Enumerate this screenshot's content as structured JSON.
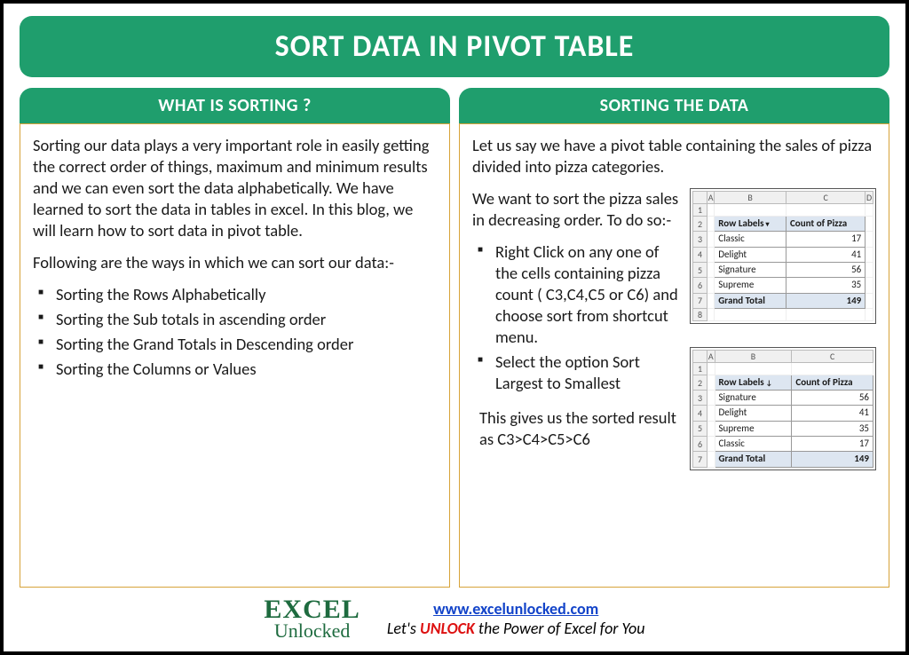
{
  "title": "SORT DATA IN PIVOT TABLE",
  "left": {
    "header": "WHAT IS SORTING ?",
    "para1": "Sorting our data plays a very important role in easily getting the correct order of things, maximum and minimum results and we can even sort the data alphabetically. We have learned to sort the data in tables in excel. In this blog, we will learn how to sort data in pivot table.",
    "para2": "Following are the ways in which we can sort our data:-",
    "bullets": [
      "Sorting the Rows Alphabetically",
      "Sorting the Sub totals in ascending order",
      "Sorting the Grand Totals in Descending order",
      "Sorting the Columns or Values"
    ]
  },
  "right": {
    "header": "SORTING THE DATA",
    "intro": "Let us say we have a pivot table containing the sales of pizza divided into pizza categories.",
    "lead": "We want to sort the pizza sales in decreasing order. To do so:-",
    "steps": [
      "Right Click on any one of the cells containing pizza count ( C3,C4,C5 or C6) and choose sort from shortcut menu.",
      "Select the option Sort Largest to Smallest"
    ],
    "result": "This gives us the sorted result as C3>C4>C5>C6"
  },
  "pivot": {
    "cols": [
      "A",
      "B",
      "C",
      "D"
    ],
    "cols2": [
      "A",
      "B",
      "C"
    ],
    "label_header": "Row Labels",
    "value_header": "Count of Pizza",
    "grand_total_label": "Grand Total",
    "grand_total_value": "149",
    "before": [
      {
        "label": "Classic",
        "value": "17"
      },
      {
        "label": "Delight",
        "value": "41"
      },
      {
        "label": "Signature",
        "value": "56"
      },
      {
        "label": "Supreme",
        "value": "35"
      }
    ],
    "after": [
      {
        "label": "Signature",
        "value": "56"
      },
      {
        "label": "Delight",
        "value": "41"
      },
      {
        "label": "Supreme",
        "value": "35"
      },
      {
        "label": "Classic",
        "value": "17"
      }
    ]
  },
  "footer": {
    "logo_top": "EXCEL",
    "logo_bottom": "Unlocked",
    "url": "www.excelunlocked.com",
    "tagline_pre": "Let's ",
    "tagline_strong": "UNLOCK",
    "tagline_post": " the Power of Excel for You"
  }
}
